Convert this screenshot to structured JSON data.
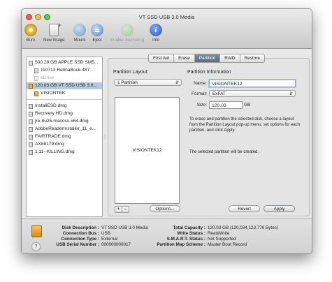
{
  "window": {
    "title": "VT SSD USB 3.0 Media"
  },
  "toolbar": {
    "items": [
      {
        "label": "Burn",
        "icon": "burn-icon"
      },
      {
        "label": "New Image",
        "icon": "new-image-icon"
      },
      {
        "label": "Mount",
        "icon": "mount-icon"
      },
      {
        "label": "Eject",
        "icon": "eject-icon"
      },
      {
        "label": "Enable Journaling",
        "icon": "journaling-icon"
      },
      {
        "label": "Info",
        "icon": "info-icon"
      }
    ]
  },
  "sidebar": {
    "items": [
      {
        "label": "500.28 GB APPLE SSD SM5...",
        "kind": "disk"
      },
      {
        "label": "110713 RetinaBook 487...",
        "kind": "volume"
      },
      {
        "label": "eDrive",
        "kind": "volume"
      },
      {
        "label": "120.03 GB VT SSD USB 3.0...",
        "kind": "disk"
      },
      {
        "label": "VISIONTEK",
        "kind": "volume"
      },
      {
        "label": "InstallESD.dmg",
        "kind": "image"
      },
      {
        "label": "Recovery HD.dmg",
        "kind": "image"
      },
      {
        "label": "jre-8u25-macosx-x64.dmg",
        "kind": "image"
      },
      {
        "label": "AdobeReaderInstaller_11_e...",
        "kind": "image"
      },
      {
        "label": "FAIRTRADE.dmg",
        "kind": "image"
      },
      {
        "label": "AX88179.dmg",
        "kind": "image"
      },
      {
        "label": "1.11--KILLING.dmg",
        "kind": "image"
      }
    ]
  },
  "tabs": [
    "First Aid",
    "Erase",
    "Partition",
    "RAID",
    "Restore"
  ],
  "partition": {
    "layout_label": "Partition Layout:",
    "layout_value": "1 Partition",
    "partition_name": "VISIONTEK12",
    "options_button": "Options...",
    "plus": "+",
    "minus": "–"
  },
  "info": {
    "heading": "Partition Information",
    "name_label": "Name:",
    "name_value": "VISIONTEK12",
    "format_label": "Format:",
    "format_value": "ExFAT",
    "size_label": "Size:",
    "size_value": "120.03",
    "size_unit": "GB",
    "help_text": "To erase and partition the selected disk, choose a layout from the Partition Layout pop-up menu, set options for each partition, and click Apply.",
    "status_text": "The selected partition will be created."
  },
  "buttons": {
    "revert": "Revert",
    "apply": "Apply"
  },
  "details": {
    "left": [
      {
        "key": "Disk Description :",
        "value": "VT SSD USB 3.0 Media"
      },
      {
        "key": "Connection Bus :",
        "value": "USB"
      },
      {
        "key": "Connection Type :",
        "value": "External"
      },
      {
        "key": "USB Serial Number :",
        "value": "000000000017"
      }
    ],
    "right": [
      {
        "key": "Total Capacity :",
        "value": "120.03 GB (120,034,123,776 Bytes)"
      },
      {
        "key": "Write Status :",
        "value": "Read/Write"
      },
      {
        "key": "S.M.A.R.T. Status :",
        "value": "Not Supported"
      },
      {
        "key": "Partition Map Scheme :",
        "value": "Master Boot Record"
      }
    ],
    "help": "?"
  }
}
